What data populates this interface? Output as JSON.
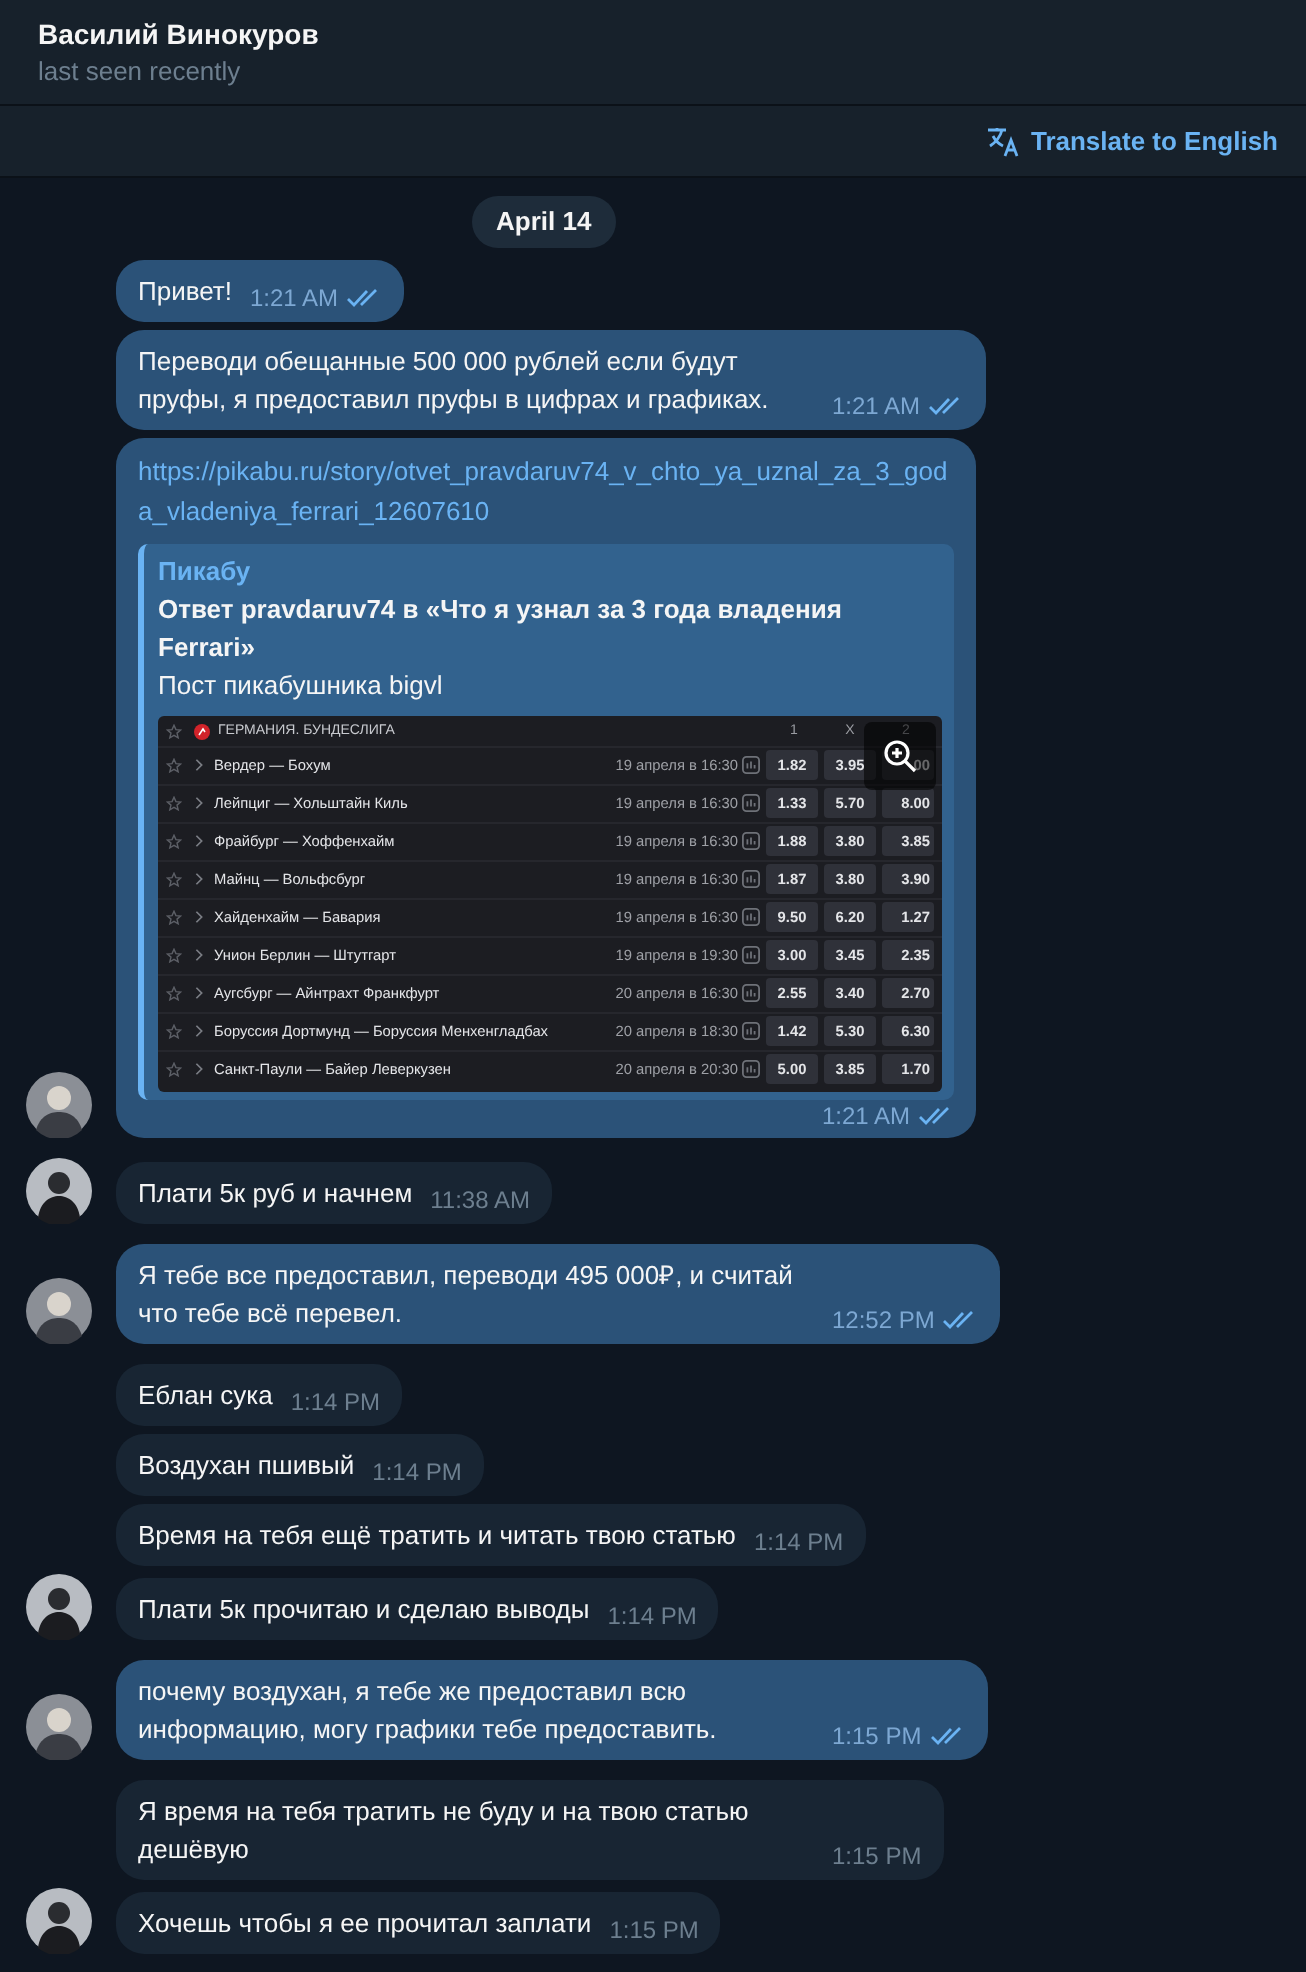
{
  "header": {
    "title": "Василий Винокуров",
    "status": "last seen recently"
  },
  "translate": {
    "label": "Translate to English"
  },
  "date_chip": "April 14",
  "messages": [
    {
      "kind": "outgoing",
      "text": "Привет!",
      "time": "1:21 AM",
      "read": true,
      "avatar": false
    },
    {
      "kind": "outgoing",
      "text": "Переводи обещанные 500 000 рублей если будут пруфы, я предоставил пруфы в цифрах и графиках.",
      "time": "1:21 AM",
      "read": true,
      "avatar": false
    },
    {
      "kind": "outgoing",
      "link": "https://pikabu.ru/story/otvet_pravdaruv74_v_chto_ya_uznal_za_3_goda_vladeniya_ferrari_12607610",
      "time": "1:21 AM",
      "read": true,
      "avatar": true,
      "preview": {
        "site": "Пикабу",
        "title": "Ответ pravdaruv74 в «Что я узнал за 3 года владения Ferrari»",
        "description": "Пост пикабушника bigvl",
        "image": {
          "league": "ГЕРМАНИЯ. БУНДЕСЛИГА",
          "columns": [
            "1",
            "X",
            "2"
          ],
          "rows": [
            {
              "match": "Вердер — Бохум",
              "date": "19 апреля в 16:30",
              "odds": [
                "1.82",
                "3.95",
                "00"
              ]
            },
            {
              "match": "Лейпциг — Хольштайн Киль",
              "date": "19 апреля в 16:30",
              "odds": [
                "1.33",
                "5.70",
                "8.00"
              ]
            },
            {
              "match": "Фрайбург — Хоффенхайм",
              "date": "19 апреля в 16:30",
              "odds": [
                "1.88",
                "3.80",
                "3.85"
              ]
            },
            {
              "match": "Майнц — Вольфсбург",
              "date": "19 апреля в 16:30",
              "odds": [
                "1.87",
                "3.80",
                "3.90"
              ]
            },
            {
              "match": "Хайденхайм — Бавария",
              "date": "19 апреля в 16:30",
              "odds": [
                "9.50",
                "6.20",
                "1.27"
              ]
            },
            {
              "match": "Унион Берлин — Штутгарт",
              "date": "19 апреля в 19:30",
              "odds": [
                "3.00",
                "3.45",
                "2.35"
              ]
            },
            {
              "match": "Аугсбург — Айнтрахт Франкфурт",
              "date": "20 апреля в 16:30",
              "odds": [
                "2.55",
                "3.40",
                "2.70"
              ]
            },
            {
              "match": "Боруссия Дортмунд — Боруссия Менхенгладбах",
              "date": "20 апреля в 18:30",
              "odds": [
                "1.42",
                "5.30",
                "6.30"
              ]
            },
            {
              "match": "Санкт-Паули — Байер Леверкузен",
              "date": "20 апреля в 20:30",
              "odds": [
                "5.00",
                "3.85",
                "1.70"
              ]
            }
          ]
        }
      }
    },
    {
      "kind": "incoming",
      "text": "Плати 5к руб и начнем",
      "time": "11:38 AM",
      "avatar": true
    },
    {
      "kind": "outgoing",
      "text": "Я тебе все предоставил, переводи 495 000₽, и считай что тебе всё перевел.",
      "time": "12:52 PM",
      "read": true,
      "avatar": true
    },
    {
      "kind": "incoming",
      "text": "Еблан сука",
      "time": "1:14 PM",
      "avatar": false
    },
    {
      "kind": "incoming",
      "text": "Воздухан пшивый",
      "time": "1:14 PM",
      "avatar": false
    },
    {
      "kind": "incoming",
      "text": "Время на тебя ещё тратить и читать твою статью",
      "time": "1:14 PM",
      "avatar": false
    },
    {
      "kind": "incoming",
      "text": "Плати 5к прочитаю и сделаю выводы",
      "time": "1:14 PM",
      "avatar": true
    },
    {
      "kind": "outgoing",
      "text": "почему воздухан, я тебе же предоставил всю информацию, могу графики тебе предоставить.",
      "time": "1:15 PM",
      "read": true,
      "avatar": true
    },
    {
      "kind": "incoming",
      "text": "Я время на тебя тратить не буду и на твою статью дешёвую",
      "time": "1:15 PM",
      "avatar": false
    },
    {
      "kind": "incoming",
      "text": "Хочешь чтобы я ее прочитал заплати",
      "time": "1:15 PM",
      "avatar": true
    }
  ]
}
